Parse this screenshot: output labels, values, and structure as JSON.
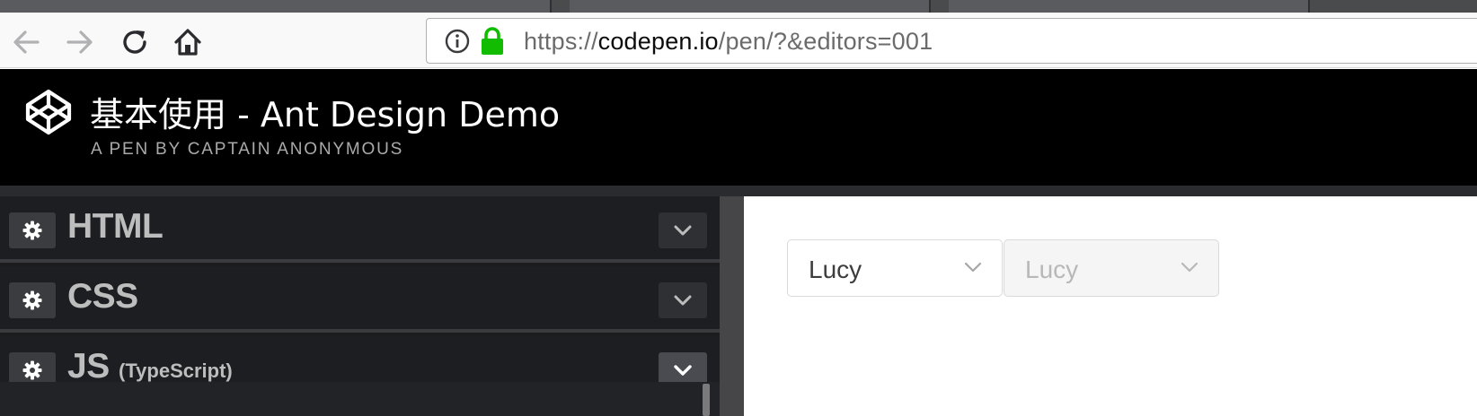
{
  "browser": {
    "url_scheme": "https://",
    "url_host": "codepen.io",
    "url_path": "/pen/?&editors=001"
  },
  "header": {
    "title": "基本使用 - Ant Design Demo",
    "subtitle": "A PEN BY CAPTAIN ANONYMOUS"
  },
  "editors": [
    {
      "title": "HTML",
      "preprocessor": ""
    },
    {
      "title": "CSS",
      "preprocessor": ""
    },
    {
      "title": "JS",
      "preprocessor": "(TypeScript)"
    }
  ],
  "preview": {
    "select_enabled": {
      "value": "Lucy"
    },
    "select_disabled": {
      "value": "Lucy"
    }
  },
  "colors": {
    "header_bg": "#000000",
    "editor_bg": "#1d1e22",
    "lock_green": "#12bc00"
  }
}
